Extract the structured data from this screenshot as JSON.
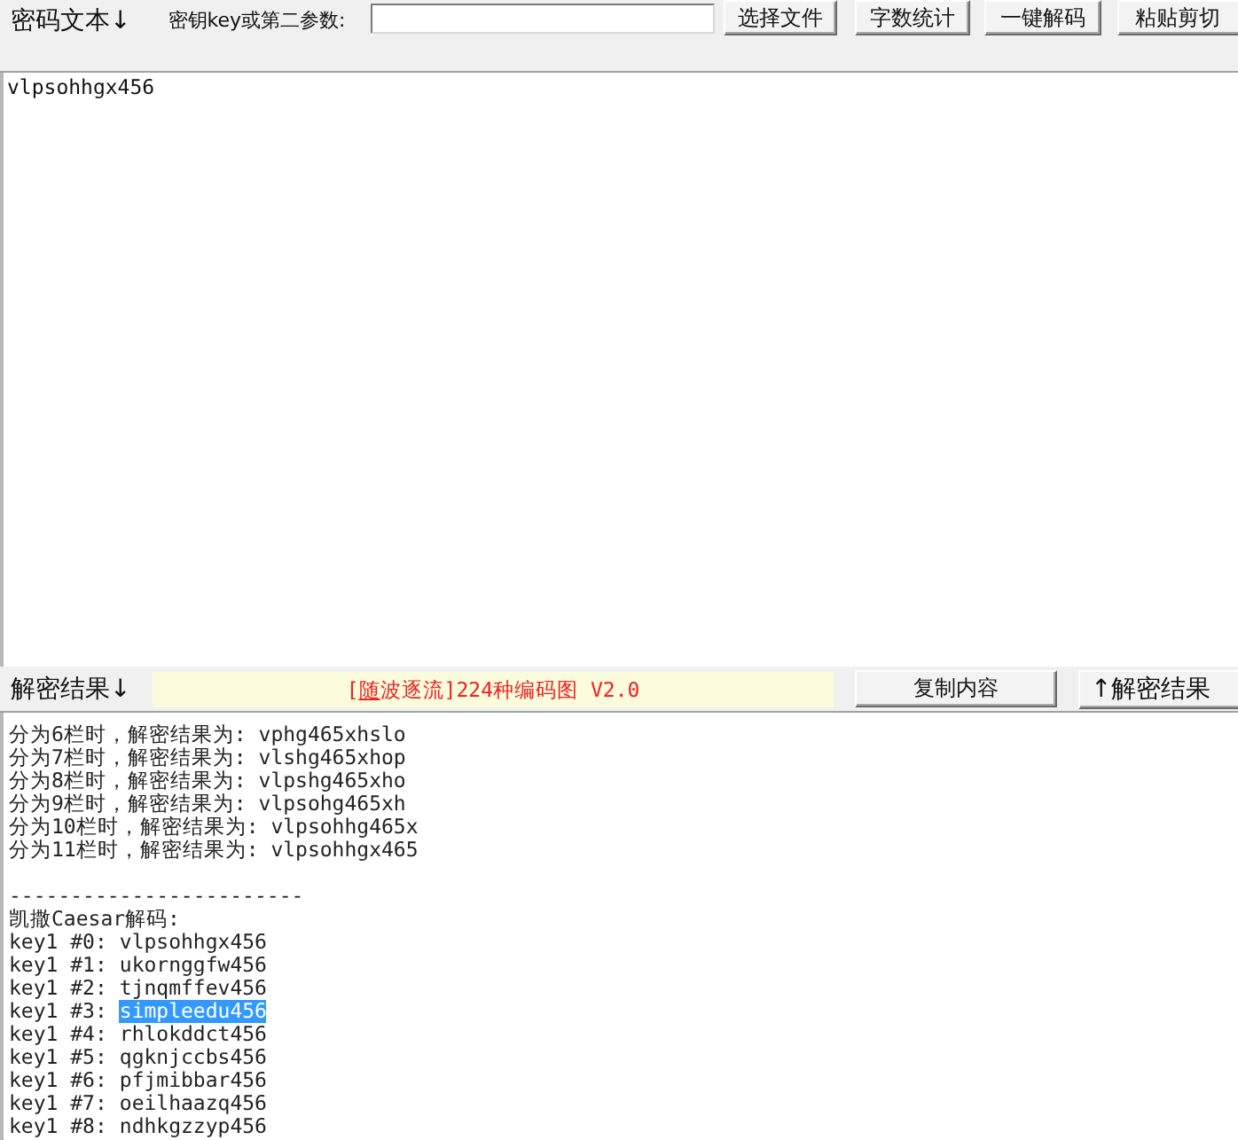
{
  "toolbar": {
    "cipher_label": "密码文本↓",
    "key_label": "密钥key或第二参数:",
    "buttons": [
      {
        "label": "选择文件"
      },
      {
        "label": "字数统计"
      },
      {
        "label": "一键解码"
      },
      {
        "label": "粘贴剪切"
      }
    ]
  },
  "cipher_text": {
    "value": "vlpsohhgx456"
  },
  "result_bar": {
    "label": "解密结果↓",
    "banner": {
      "text": "[随波逐流]224种编码图 V2.0"
    },
    "copy_button": "复制内容",
    "transfer_button": "↑解密结果"
  },
  "result_text": {
    "rail_lines": [
      "分为6栏时，解密结果为: vphg465xhslo",
      "分为7栏时，解密结果为: vlshg465xhop",
      "分为8栏时，解密结果为: vlpshg465xho",
      "分为9栏时，解密结果为: vlpsohg465xh",
      "分为10栏时，解密结果为: vlpsohhg465x",
      "分为11栏时，解密结果为: vlpsohhgx465"
    ],
    "separator": "------------------------",
    "caesar_title": "凯撒Caesar解码:",
    "caesar_rows": [
      {
        "key": "key1 #0:",
        "value": "vlpsohhgx456",
        "selected": false
      },
      {
        "key": "key1 #1:",
        "value": "ukornggfw456",
        "selected": false
      },
      {
        "key": "key1 #2:",
        "value": "tjnqmffev456",
        "selected": false
      },
      {
        "key": "key1 #3:",
        "value": "simpleedu456",
        "selected": true
      },
      {
        "key": "key1 #4:",
        "value": "rhlokddct456",
        "selected": false
      },
      {
        "key": "key1 #5:",
        "value": "qgknjccbs456",
        "selected": false
      },
      {
        "key": "key1 #6:",
        "value": "pfjmibbar456",
        "selected": false
      },
      {
        "key": "key1 #7:",
        "value": "oeilhaazq456",
        "selected": false
      },
      {
        "key": "key1 #8:",
        "value": "ndhkgzzyp456",
        "selected": false
      }
    ]
  }
}
